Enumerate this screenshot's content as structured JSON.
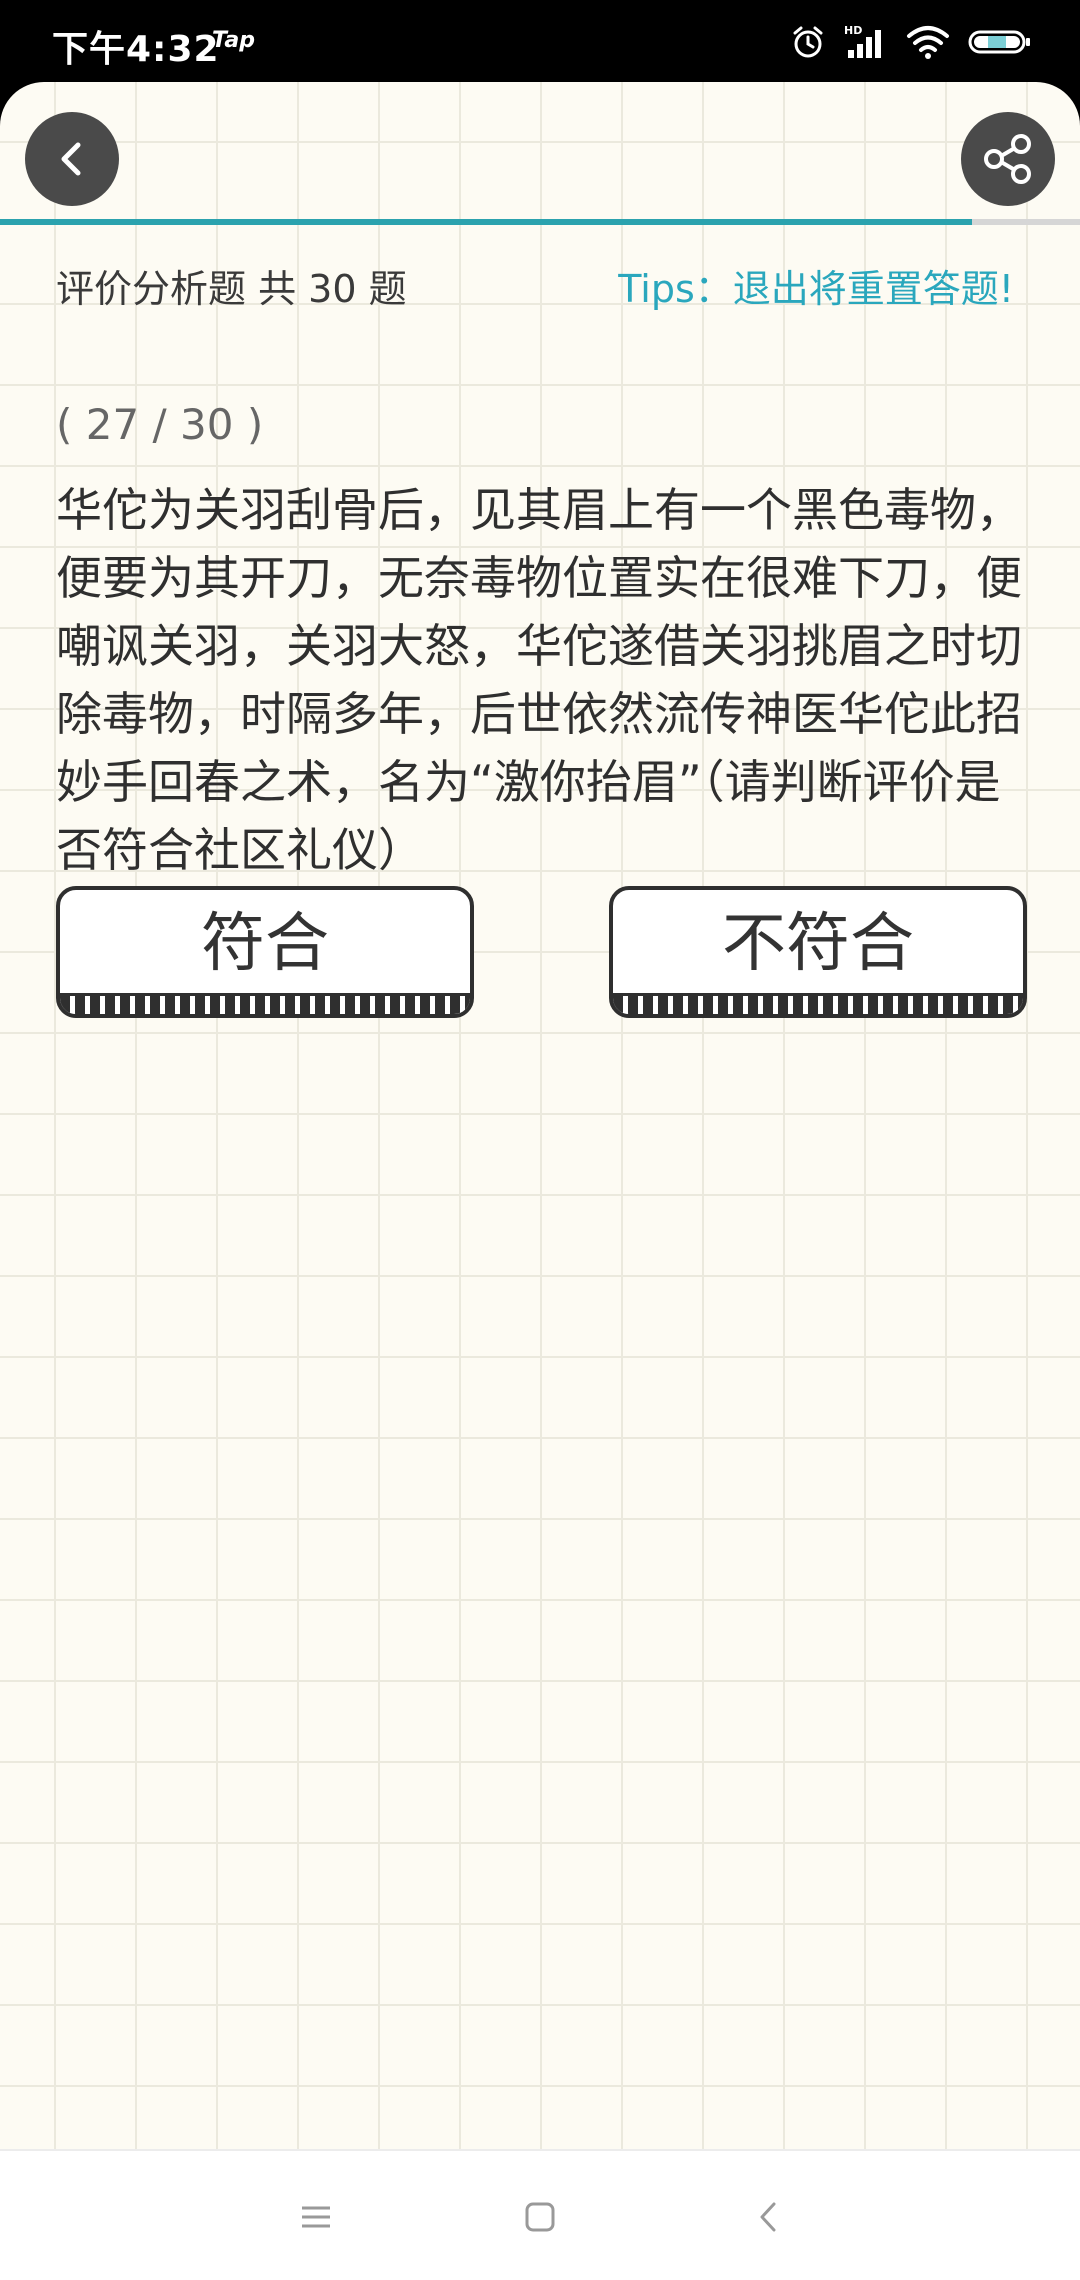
{
  "status_bar": {
    "time": "下午4:32",
    "app_label": "Tap",
    "icons": [
      "alarm-icon",
      "signal-icon",
      "wifi-icon",
      "battery-icon"
    ],
    "hd_label": "HD"
  },
  "header": {
    "back_icon": "chevron-left-icon",
    "share_icon": "share-icon"
  },
  "progress": {
    "fraction": 0.9
  },
  "quiz": {
    "category": "评价分析题 共 30 题",
    "tips": "Tips：退出将重置答题!",
    "index": "( 27 / 30 )",
    "question": "华佗为关羽刮骨后，见其眉上有一个黑色毒物，便要为其开刀，无奈毒物位置实在很难下刀，便嘲讽关羽，关羽大怒，华佗遂借关羽挑眉之时切除毒物，时隔多年，后世依然流传神医华佗此招妙手回春之术，名为“激你抬眉”（请判断评价是否符合社区礼仪）"
  },
  "answers": {
    "yes_label": "符合",
    "no_label": "不符合"
  },
  "colors": {
    "accent": "#2ba2ae",
    "tips": "#2aa7bd",
    "background": "#fdfbf3",
    "button_border": "#2f2f2f"
  },
  "nav_bar": {
    "icons": [
      "menu-icon",
      "home-icon",
      "back-icon"
    ]
  }
}
